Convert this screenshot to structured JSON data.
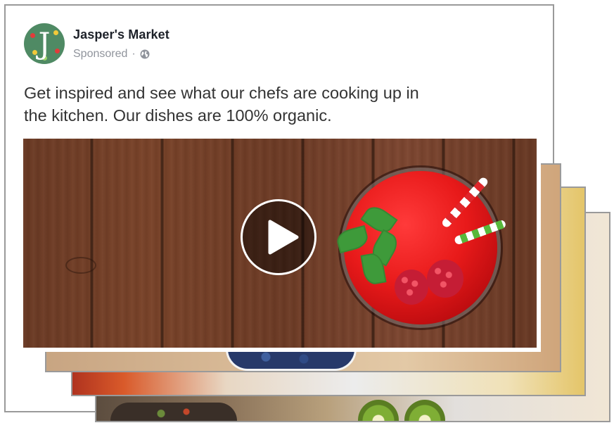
{
  "post": {
    "page_name": "Jasper's Market",
    "sponsored_label": "Sponsored",
    "separator": "·",
    "privacy_icon": "globe-icon",
    "avatar_letter": "J",
    "text": "Get inspired and see what our chefs are cooking up in the kitchen. Our dishes are 100% organic."
  },
  "media": {
    "type": "video",
    "play_icon": "play-icon",
    "carousel_cards_behind": 3
  },
  "colors": {
    "avatar_bg": "#4f8a64",
    "page_name": "#1d2129",
    "meta_text": "#90949c",
    "body_text": "#333333",
    "card_border": "#9a9a9a"
  }
}
